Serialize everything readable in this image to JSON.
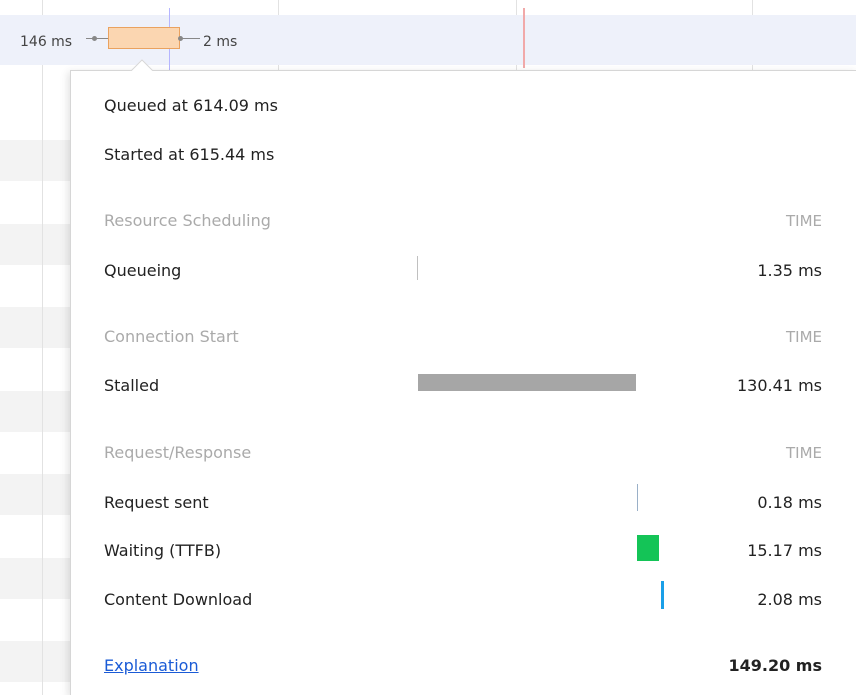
{
  "timeline": {
    "left_label": "146 ms",
    "right_label": "2 ms"
  },
  "popover": {
    "queued": "Queued at 614.09 ms",
    "started": "Started at 615.44 ms",
    "sections": [
      {
        "title": "Resource Scheduling",
        "time_header": "TIME",
        "rows": [
          {
            "label": "Queueing",
            "time": "1.35 ms"
          }
        ]
      },
      {
        "title": "Connection Start",
        "time_header": "TIME",
        "rows": [
          {
            "label": "Stalled",
            "time": "130.41 ms"
          }
        ]
      },
      {
        "title": "Request/Response",
        "time_header": "TIME",
        "rows": [
          {
            "label": "Request sent",
            "time": "0.18 ms"
          },
          {
            "label": "Waiting (TTFB)",
            "time": "15.17 ms"
          },
          {
            "label": "Content Download",
            "time": "2.08 ms"
          }
        ]
      }
    ],
    "explanation_link": "Explanation",
    "total": "149.20 ms"
  },
  "colors": {
    "stalled_bar": "#a6a6a6",
    "waiting_bar": "#14c457",
    "download_bar": "#1a9fe8",
    "queue_bar": "#c0c0c0",
    "link": "#1a5bd6"
  }
}
